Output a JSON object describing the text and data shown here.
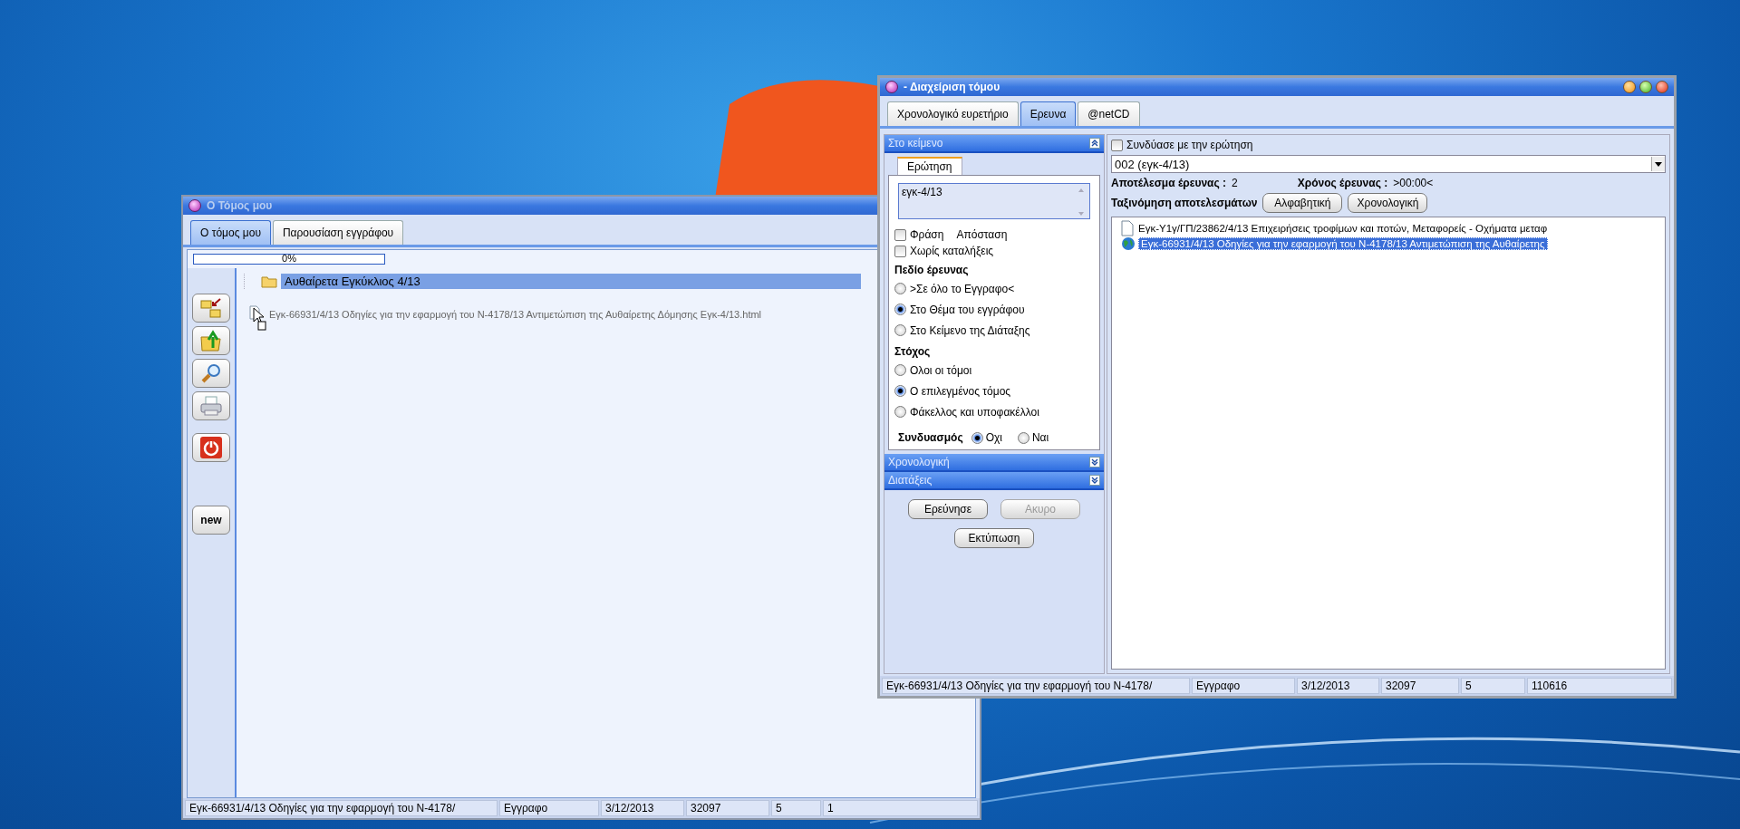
{
  "volume_window": {
    "title": "Ο Τόμος μου",
    "tabs": [
      {
        "label": "Ο τόμος μου",
        "selected": true
      },
      {
        "label": "Παρουσίαση εγγράφου",
        "selected": false
      }
    ],
    "progress": {
      "label": "0%",
      "level": 0
    },
    "new_button": "new",
    "tree": {
      "folder": {
        "label": "Αυθαίρετα Εγκύκλιος 4/13",
        "selected": true
      },
      "files": [
        {
          "label": "Εγκ-66931/4/13 Οδηγίες για την εφαρμογή του Ν-4178/13 Αντιμετώπιση της Αυθαίρετης Δόμησης Εγκ-4/13.html"
        }
      ]
    },
    "status_bar": [
      "Εγκ-66931/4/13 Οδηγίες για την εφαρμογή του Ν-4178/",
      "Εγγραφο",
      "3/12/2013",
      "32097",
      "5",
      "1"
    ]
  },
  "manager_window": {
    "title": "- Διαχείριση τόμου",
    "tabs": [
      {
        "label": "Χρονολογικό ευρετήριο",
        "selected": false
      },
      {
        "label": "Ερευνα",
        "selected": true
      },
      {
        "label": "@netCD",
        "selected": false
      }
    ],
    "text_section": {
      "title": "Στο κείμενο",
      "expanded": true,
      "query_tab": "Ερώτηση",
      "query": "εγκ-4/13",
      "phrase": {
        "label": "Φράση",
        "checked": false
      },
      "distance_label": "Απόσταση",
      "no_endings": {
        "label": "Χωρίς καταλήξεις",
        "checked": false
      },
      "field_group": {
        "title": "Πεδίο έρευνας",
        "options": [
          {
            "label": ">Σε όλο το Εγγραφο<",
            "selected": false
          },
          {
            "label": "Στο Θέμα του εγγράφου",
            "selected": true
          },
          {
            "label": "Στο Κείμενο της Διάταξης",
            "selected": false
          }
        ]
      },
      "target_group": {
        "title": "Στόχος",
        "options": [
          {
            "label": "Ολοι οι τόμοι",
            "selected": false
          },
          {
            "label": "Ο επιλεγμένος τόμος",
            "selected": true
          },
          {
            "label": "Φάκελλος και υποφακέλλοι",
            "selected": false
          }
        ]
      },
      "combination": {
        "label": "Συνδυασμός",
        "options": [
          {
            "label": "Οχι",
            "selected": true
          },
          {
            "label": "Ναι",
            "selected": false
          }
        ]
      }
    },
    "sections": [
      {
        "title": "Χρονολογική",
        "expanded": false
      },
      {
        "title": "Διατάξεις",
        "expanded": false
      }
    ],
    "buttons": [
      {
        "label": "Ερεύνησε",
        "disabled": false
      },
      {
        "label": "Ακυρο",
        "disabled": true
      },
      {
        "label": "Εκτύπωση",
        "disabled": false
      }
    ],
    "results": {
      "combine": {
        "label": "Συνδύασε με την ερώτηση",
        "checked": false
      },
      "query_select": "002 (εγκ-4/13)",
      "count_label": "Αποτέλεσμα έρευνας :",
      "count": "2",
      "time_label": "Χρόνος έρευνας :",
      "time": ">00:00<",
      "sort_label": "Ταξινόμηση αποτελεσμάτων",
      "sort_buttons": [
        "Αλφαβητική",
        "Χρονολογική"
      ],
      "items": [
        {
          "kind": "document",
          "label": "Εγκ-Υ1γ/ΓΠ/23862/4/13 Επιχειρήσεις τροφίμων και ποτών, Μεταφορείς - Οχήματα μεταφ",
          "selected": false
        },
        {
          "kind": "web",
          "label": "Εγκ-66931/4/13 Οδηγίες για την εφαρμογή του Ν-4178/13 Αντιμετώπιση της Αυθαίρετης",
          "selected": true
        }
      ]
    },
    "status_bar": [
      "Εγκ-66931/4/13 Οδηγίες για την εφαρμογή του Ν-4178/",
      "Εγγραφο",
      "3/12/2013",
      "32097",
      "5",
      "110616"
    ]
  }
}
